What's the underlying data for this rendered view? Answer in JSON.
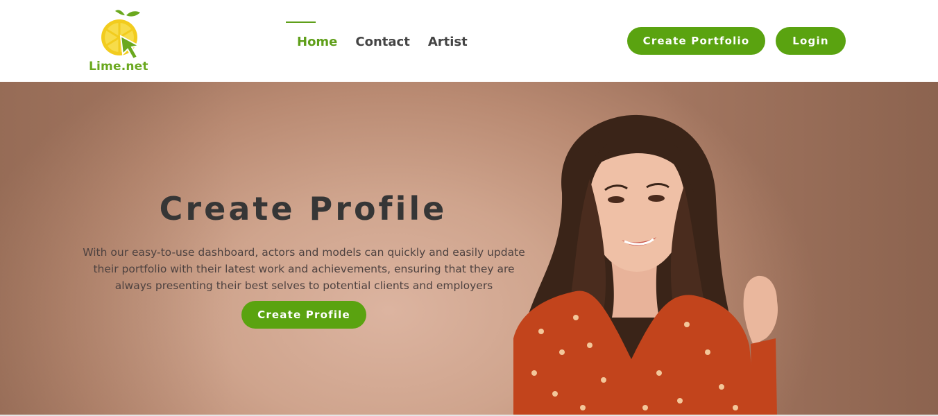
{
  "brand": {
    "name": "Lime.net",
    "colors": {
      "accent": "#5aa310",
      "logo_yellow": "#f2cc1e",
      "text_dark": "#363636"
    },
    "logo_icon": "lime-slice-cursor-icon"
  },
  "nav": {
    "items": [
      {
        "label": "Home",
        "active": true
      },
      {
        "label": "Contact",
        "active": false
      },
      {
        "label": "Artist",
        "active": false
      }
    ]
  },
  "header_actions": {
    "create_portfolio_label": "Create Portfolio",
    "login_label": "Login"
  },
  "hero": {
    "title": "Create Profile",
    "description": "With our easy-to-use dashboard, actors and models can quickly and easily update their portfolio with their latest work and achievements, ensuring that they are always presenting their best selves to potential clients and employers",
    "cta_label": "Create Profile",
    "image": "smiling-woman-red-floral-dress-photo"
  }
}
